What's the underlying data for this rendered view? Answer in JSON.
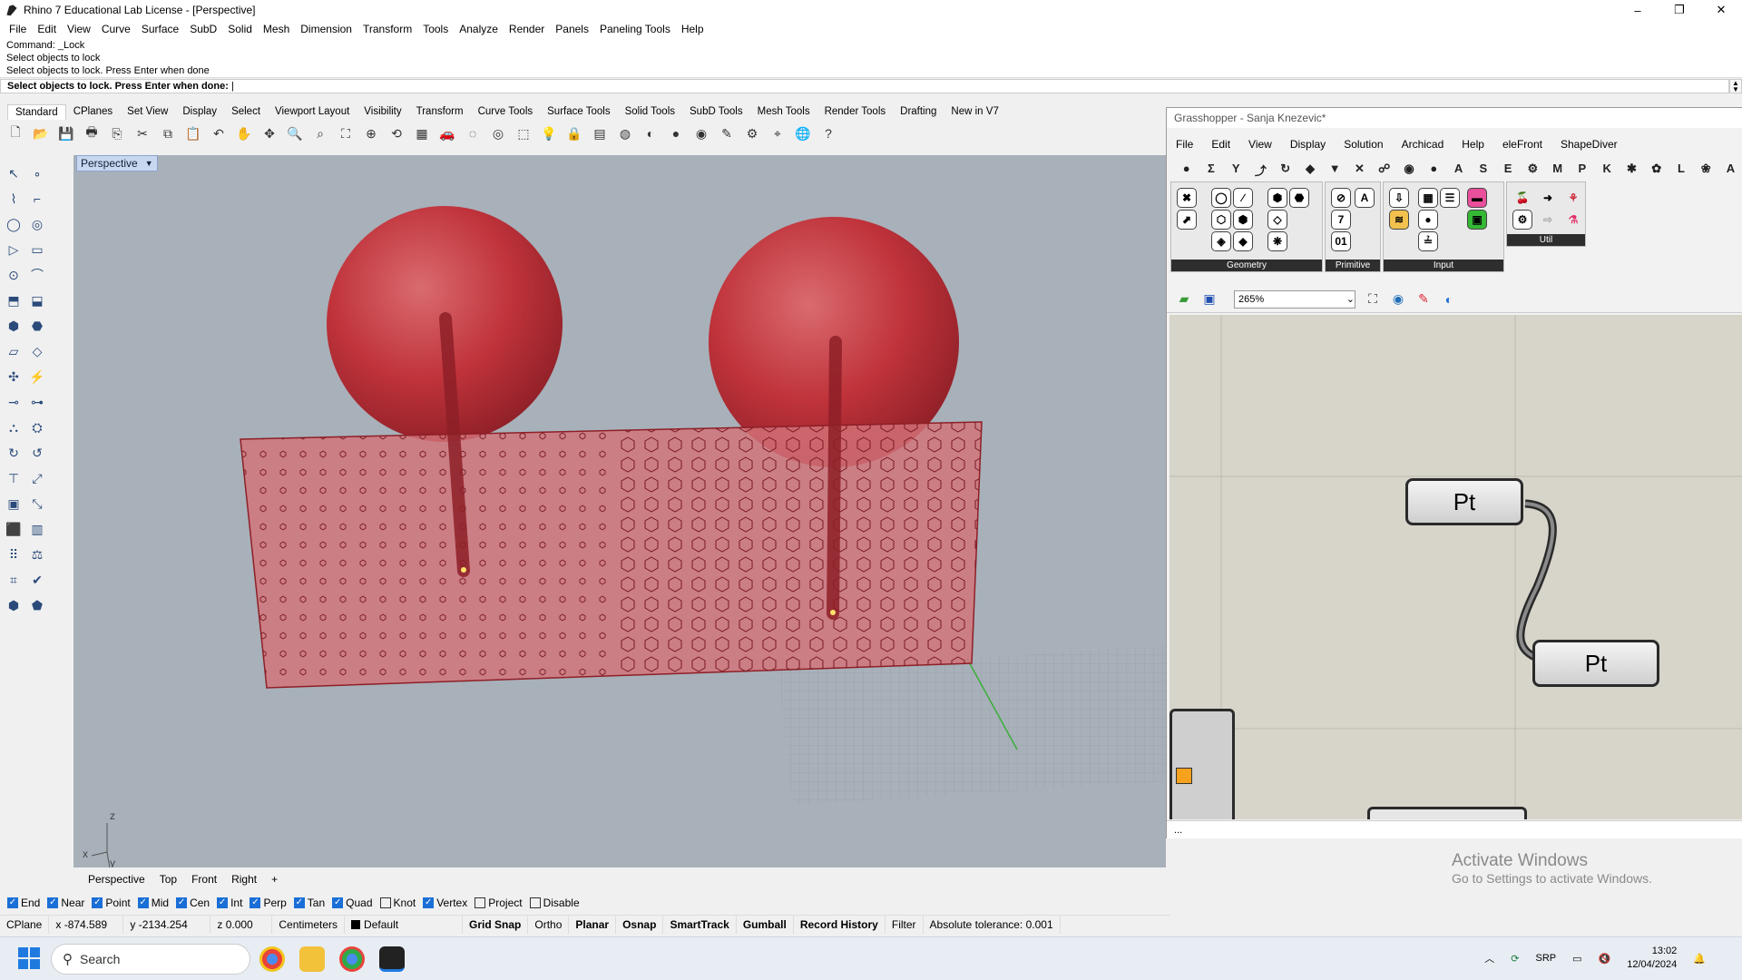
{
  "window": {
    "title": "Rhino 7 Educational Lab License - [Perspective]",
    "controls": [
      "–",
      "❐",
      "✕"
    ]
  },
  "menu": [
    "File",
    "Edit",
    "View",
    "Curve",
    "Surface",
    "SubD",
    "Solid",
    "Mesh",
    "Dimension",
    "Transform",
    "Tools",
    "Analyze",
    "Render",
    "Panels",
    "Paneling Tools",
    "Help"
  ],
  "command": {
    "history": [
      "Command: _Lock",
      "Select objects to lock",
      "Select objects to lock. Press Enter when done"
    ],
    "prompt": "Select objects to lock. Press Enter when done:"
  },
  "toolbar_tabs": [
    "Standard",
    "CPlanes",
    "Set View",
    "Display",
    "Select",
    "Viewport Layout",
    "Visibility",
    "Transform",
    "Curve Tools",
    "Surface Tools",
    "Solid Tools",
    "SubD Tools",
    "Mesh Tools",
    "Render Tools",
    "Drafting",
    "New in V7"
  ],
  "toolbar_icons": [
    "new-icon",
    "open-icon",
    "save-icon",
    "print-icon",
    "import-icon",
    "cut-icon",
    "copy-icon",
    "paste-icon",
    "undo-icon",
    "pan-icon",
    "move-view-icon",
    "zoom-icon",
    "zoom-window-icon",
    "zoom-extents-icon",
    "zoom-selected-icon",
    "rotate-view-icon",
    "four-views-icon",
    "car-icon",
    "hide-icon",
    "show-icon",
    "select-icon",
    "light-icon",
    "lock-icon",
    "layer-icon",
    "color-wheel-icon",
    "render-preview-icon",
    "material-icon",
    "render-icon",
    "tool-icon",
    "settings-icon",
    "osnap-icon",
    "globe-icon",
    "help-icon"
  ],
  "viewport": {
    "label": "Perspective",
    "axis": {
      "z": "z",
      "x": "x",
      "y": "y"
    }
  },
  "viewport_tabs": [
    "Perspective",
    "Top",
    "Front",
    "Right",
    "+"
  ],
  "osnaps": [
    {
      "label": "End",
      "on": true
    },
    {
      "label": "Near",
      "on": true
    },
    {
      "label": "Point",
      "on": true
    },
    {
      "label": "Mid",
      "on": true
    },
    {
      "label": "Cen",
      "on": true
    },
    {
      "label": "Int",
      "on": true
    },
    {
      "label": "Perp",
      "on": true
    },
    {
      "label": "Tan",
      "on": true
    },
    {
      "label": "Quad",
      "on": true
    },
    {
      "label": "Knot",
      "on": false
    },
    {
      "label": "Vertex",
      "on": true
    },
    {
      "label": "Project",
      "on": false
    },
    {
      "label": "Disable",
      "on": false
    }
  ],
  "status": {
    "cplane": "CPlane",
    "x": "x -874.589",
    "y": "y -2134.254",
    "z": "z 0.000",
    "units": "Centimeters",
    "layer": "Default",
    "toggles": [
      "Grid Snap",
      "Ortho",
      "Planar",
      "Osnap",
      "SmartTrack",
      "Gumball",
      "Record History",
      "Filter"
    ],
    "bold_toggles": [
      "Grid Snap",
      "Planar",
      "Osnap",
      "SmartTrack",
      "Gumball",
      "Record History"
    ],
    "tolerance": "Absolute tolerance: 0.001"
  },
  "grasshopper": {
    "title": "Grasshopper - Sanja Knezevic*",
    "menu": [
      "File",
      "Edit",
      "View",
      "Display",
      "Solution",
      "Archicad",
      "Help",
      "eleFront",
      "ShapeDiver"
    ],
    "tabs": [
      "●",
      "Σ",
      "Y",
      "⤴",
      "↻",
      "◆",
      "▼",
      "✕",
      "☍",
      "◉",
      "●",
      "A",
      "S",
      "E",
      "⚙",
      "M",
      "P",
      "K",
      "✱",
      "✿",
      "L",
      "❀",
      "A"
    ],
    "panels": [
      "Geometry",
      "Primitive",
      "Input",
      "Util"
    ],
    "zoom": "265%",
    "nodes": [
      "Pt",
      "Pt"
    ],
    "status": "..."
  },
  "watermark": {
    "line1": "Activate Windows",
    "line2": "Go to Settings to activate Windows."
  },
  "taskbar": {
    "search": "Search",
    "lang": "SRP",
    "time": "13:02",
    "date": "12/04/2024"
  },
  "colors": {
    "viewport_bg": "#a8b0b9",
    "object_red": "#c8323a",
    "gh_canvas": "#d7d4ca",
    "accent": "#1a6fd6"
  }
}
